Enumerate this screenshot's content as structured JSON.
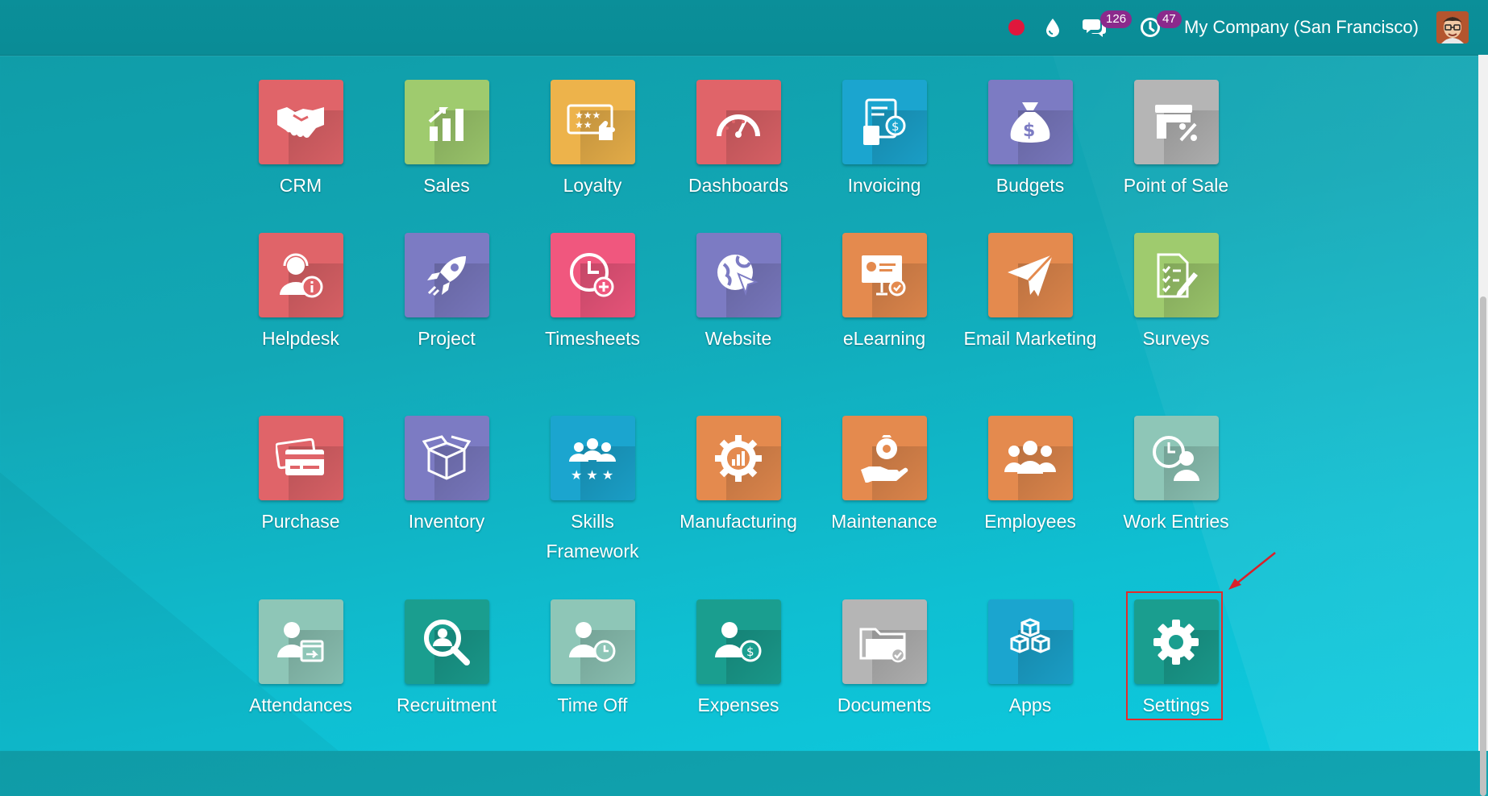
{
  "navbar": {
    "chat_count": "126",
    "activity_count": "47",
    "company": "My Company (San Francisco)"
  },
  "apps": [
    {
      "label": "CRM",
      "icon": "handshake-icon",
      "color": "#e06469"
    },
    {
      "label": "Sales",
      "icon": "sales-chart-icon",
      "color": "#9fcb6e"
    },
    {
      "label": "Loyalty",
      "icon": "loyalty-card-icon",
      "color": "#edb34b"
    },
    {
      "label": "Dashboards",
      "icon": "speedometer-icon",
      "color": "#e06469"
    },
    {
      "label": "Invoicing",
      "icon": "invoice-icon",
      "color": "#1ba5cf"
    },
    {
      "label": "Budgets",
      "icon": "money-bag-icon",
      "color": "#7c7bc3"
    },
    {
      "label": "Point of Sale",
      "icon": "shop-icon",
      "color": "#b5b5b5"
    },
    {
      "label": "Helpdesk",
      "icon": "support-agent-icon",
      "color": "#e06469"
    },
    {
      "label": "Project",
      "icon": "rocket-icon",
      "color": "#7c7bc3"
    },
    {
      "label": "Timesheets",
      "icon": "clock-plus-icon",
      "color": "#f0577e"
    },
    {
      "label": "Website",
      "icon": "globe-cursor-icon",
      "color": "#7c7bc3"
    },
    {
      "label": "eLearning",
      "icon": "presentation-icon",
      "color": "#e48a4e"
    },
    {
      "label": "Email Marketing",
      "icon": "paper-plane-icon",
      "color": "#e48a4e"
    },
    {
      "label": "Surveys",
      "icon": "survey-icon",
      "color": "#9fcb6e"
    },
    {
      "label": "Purchase",
      "icon": "credit-card-icon",
      "color": "#e06469"
    },
    {
      "label": "Inventory",
      "icon": "box-icon",
      "color": "#7c7bc3"
    },
    {
      "label": "Skills Framework",
      "icon": "team-stars-icon",
      "color": "#1ba5cf"
    },
    {
      "label": "Manufacturing",
      "icon": "gear-chart-icon",
      "color": "#e48a4e"
    },
    {
      "label": "Maintenance",
      "icon": "hand-gear-icon",
      "color": "#e48a4e"
    },
    {
      "label": "Employees",
      "icon": "people-icon",
      "color": "#e48a4e"
    },
    {
      "label": "Work Entries",
      "icon": "clock-person-icon",
      "color": "#8ec6b7"
    },
    {
      "label": "Attendances",
      "icon": "person-calendar-icon",
      "color": "#8ec6b7"
    },
    {
      "label": "Recruitment",
      "icon": "magnifier-icon",
      "color": "#1a9e8f"
    },
    {
      "label": "Time Off",
      "icon": "person-clock-icon",
      "color": "#8ec6b7"
    },
    {
      "label": "Expenses",
      "icon": "person-dollar-icon",
      "color": "#1a9e8f"
    },
    {
      "label": "Documents",
      "icon": "folder-icon",
      "color": "#b5b5b5"
    },
    {
      "label": "Apps",
      "icon": "cubes-icon",
      "color": "#1ba5cf"
    },
    {
      "label": "Settings",
      "icon": "gear-icon",
      "color": "#1a9e8f"
    }
  ]
}
